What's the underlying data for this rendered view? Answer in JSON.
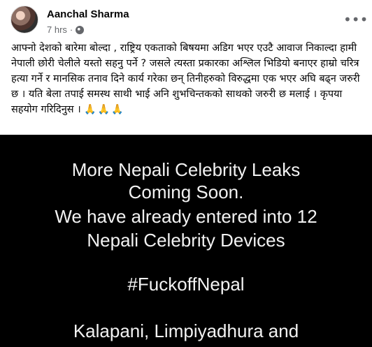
{
  "post": {
    "author": "Aanchal Sharma",
    "time": "7 hrs",
    "separator": "·",
    "body_text": "आफ्नो देशको बारेमा बोल्दा , राष्ट्रिय एकताको बिषयमा अडिग भएर एउटै आवाज निकाल्दा हामी नेपाली छोरी चेलीले यस्तो सहनु पर्ने ? जसले त्यस्ता प्रकारका अश्लिल भिडियो बनाएर हाम्रो चरित्र हत्या गर्ने र मानसिक तनाव दिने कार्य गरेका छन् तिनीहरुको विरुद्धमा  एक भएर अघि बढ्न जरुरी छ । यति बेला तपाई समस्थ साथी भाई अनि शुभचिन्तकको साथको जरुरी छ मलाई । कृपया सहयोग गरिदिनुस ।",
    "emoji_tail": "🙏🙏🙏",
    "icons": {
      "globe": "globe-icon",
      "more": "more-options-icon",
      "avatar": "profile-avatar"
    },
    "media": {
      "lines": [
        "More Nepali Celebrity Leaks",
        "Coming Soon.",
        "We have already entered into 12",
        "Nepali  Celebrity Devices",
        "#FuckoffNepal",
        "Kalapani, Limpiyadhura and"
      ]
    }
  }
}
